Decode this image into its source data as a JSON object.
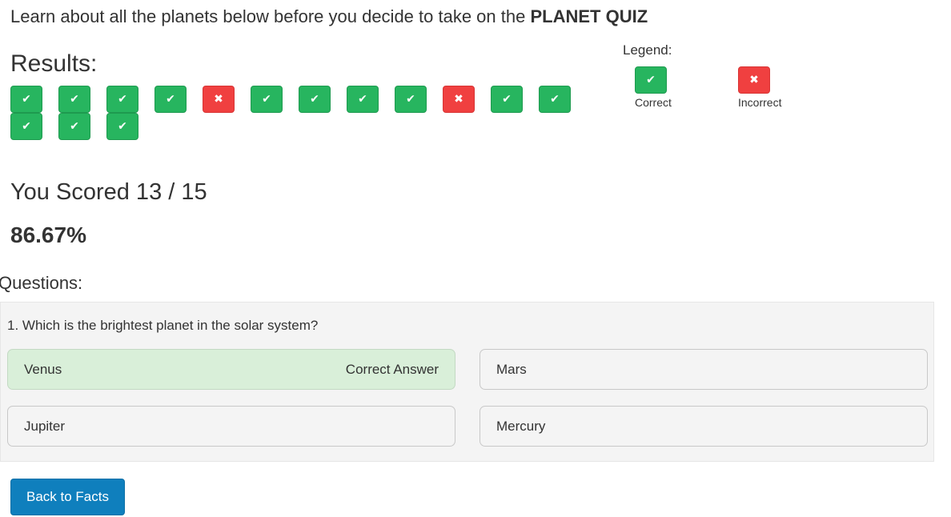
{
  "header": {
    "intro_text": "Learn about all the planets below before you decide to take on the ",
    "quiz_name": "PLANET QUIZ"
  },
  "results": {
    "title": "Results:",
    "answers": [
      "correct",
      "correct",
      "correct",
      "correct",
      "incorrect",
      "correct",
      "correct",
      "correct",
      "correct",
      "incorrect",
      "correct",
      "correct",
      "correct",
      "correct",
      "correct"
    ]
  },
  "icons": {
    "correct": "check-icon",
    "incorrect": "x-icon"
  },
  "legend": {
    "title": "Legend:",
    "correct_label": "Correct",
    "incorrect_label": "Incorrect"
  },
  "score": {
    "text": "You Scored 13 / 15",
    "percent": "86.67%"
  },
  "questions": {
    "title": "Questions:",
    "items": [
      {
        "text": "1. Which is the brightest planet in the solar system?",
        "options": [
          {
            "label": "Venus",
            "note": "Correct Answer"
          },
          {
            "label": "Mars",
            "note": ""
          },
          {
            "label": "Jupiter",
            "note": ""
          },
          {
            "label": "Mercury",
            "note": ""
          }
        ]
      }
    ]
  },
  "actions": {
    "back_label": "Back to Facts"
  },
  "colors": {
    "correct": "#27b55f",
    "incorrect": "#f04040",
    "correct_answer_bg": "#d9efd9",
    "button": "#0f7fbd"
  }
}
